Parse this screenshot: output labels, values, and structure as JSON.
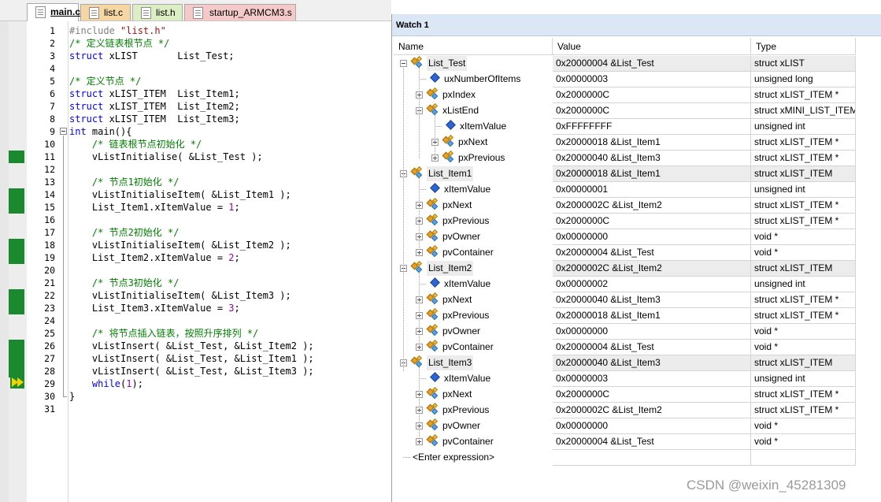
{
  "tabs": [
    {
      "label": "main.c",
      "active": true
    },
    {
      "label": "list.c",
      "active": false
    },
    {
      "label": "list.h",
      "active": false
    },
    {
      "label": "startup_ARMCM3.s",
      "active": false
    }
  ],
  "code_lines": [
    {
      "n": "1",
      "t": "#include \"list.h\""
    },
    {
      "n": "2",
      "t": "/* 定义链表根节点 */"
    },
    {
      "n": "3",
      "t": "struct xLIST       List_Test;"
    },
    {
      "n": "4",
      "t": ""
    },
    {
      "n": "5",
      "t": "/* 定义节点 */"
    },
    {
      "n": "6",
      "t": "struct xLIST_ITEM  List_Item1;"
    },
    {
      "n": "7",
      "t": "struct xLIST_ITEM  List_Item2;"
    },
    {
      "n": "8",
      "t": "struct xLIST_ITEM  List_Item3;"
    },
    {
      "n": "9",
      "t": "int main(){"
    },
    {
      "n": "10",
      "t": "    /* 链表根节点初始化 */"
    },
    {
      "n": "11",
      "t": "    vListInitialise( &List_Test );"
    },
    {
      "n": "12",
      "t": ""
    },
    {
      "n": "13",
      "t": "    /* 节点1初始化 */"
    },
    {
      "n": "14",
      "t": "    vListInitialiseItem( &List_Item1 );"
    },
    {
      "n": "15",
      "t": "    List_Item1.xItemValue = 1;"
    },
    {
      "n": "16",
      "t": ""
    },
    {
      "n": "17",
      "t": "    /* 节点2初始化 */"
    },
    {
      "n": "18",
      "t": "    vListInitialiseItem( &List_Item2 );"
    },
    {
      "n": "19",
      "t": "    List_Item2.xItemValue = 2;"
    },
    {
      "n": "20",
      "t": ""
    },
    {
      "n": "21",
      "t": "    /* 节点3初始化 */"
    },
    {
      "n": "22",
      "t": "    vListInitialiseItem( &List_Item3 );"
    },
    {
      "n": "23",
      "t": "    List_Item3.xItemValue = 3;"
    },
    {
      "n": "24",
      "t": ""
    },
    {
      "n": "25",
      "t": "    /* 将节点插入链表，按照升序排列 */"
    },
    {
      "n": "26",
      "t": "    vListInsert( &List_Test, &List_Item2 );"
    },
    {
      "n": "27",
      "t": "    vListInsert( &List_Test, &List_Item1 );"
    },
    {
      "n": "28",
      "t": "    vListInsert( &List_Test, &List_Item3 );"
    },
    {
      "n": "29",
      "t": "    while(1);"
    },
    {
      "n": "30",
      "t": "}"
    },
    {
      "n": "31",
      "t": ""
    }
  ],
  "watch": {
    "title": "Watch 1",
    "headers": {
      "name": "Name",
      "value": "Value",
      "type": "Type"
    },
    "rows": [
      {
        "name": "List_Test",
        "value": "0x20000004 &List_Test",
        "type": "struct xLIST",
        "root": true
      },
      {
        "name": "uxNumberOfItems",
        "value": "0x00000003",
        "type": "unsigned long"
      },
      {
        "name": "pxIndex",
        "value": "0x2000000C",
        "type": "struct xLIST_ITEM *"
      },
      {
        "name": "xListEnd",
        "value": "0x2000000C",
        "type": "struct xMINI_LIST_ITEM"
      },
      {
        "name": "xItemValue",
        "value": "0xFFFFFFFF",
        "type": "unsigned int"
      },
      {
        "name": "pxNext",
        "value": "0x20000018 &List_Item1",
        "type": "struct xLIST_ITEM *"
      },
      {
        "name": "pxPrevious",
        "value": "0x20000040 &List_Item3",
        "type": "struct xLIST_ITEM *"
      },
      {
        "name": "List_Item1",
        "value": "0x20000018 &List_Item1",
        "type": "struct xLIST_ITEM",
        "root": true
      },
      {
        "name": "xItemValue",
        "value": "0x00000001",
        "type": "unsigned int"
      },
      {
        "name": "pxNext",
        "value": "0x2000002C &List_Item2",
        "type": "struct xLIST_ITEM *"
      },
      {
        "name": "pxPrevious",
        "value": "0x2000000C",
        "type": "struct xLIST_ITEM *"
      },
      {
        "name": "pvOwner",
        "value": "0x00000000",
        "type": "void *"
      },
      {
        "name": "pvContainer",
        "value": "0x20000004 &List_Test",
        "type": "void *"
      },
      {
        "name": "List_Item2",
        "value": "0x2000002C &List_Item2",
        "type": "struct xLIST_ITEM",
        "root": true
      },
      {
        "name": "xItemValue",
        "value": "0x00000002",
        "type": "unsigned int"
      },
      {
        "name": "pxNext",
        "value": "0x20000040 &List_Item3",
        "type": "struct xLIST_ITEM *"
      },
      {
        "name": "pxPrevious",
        "value": "0x20000018 &List_Item1",
        "type": "struct xLIST_ITEM *"
      },
      {
        "name": "pvOwner",
        "value": "0x00000000",
        "type": "void *"
      },
      {
        "name": "pvContainer",
        "value": "0x20000004 &List_Test",
        "type": "void *"
      },
      {
        "name": "List_Item3",
        "value": "0x20000040 &List_Item3",
        "type": "struct xLIST_ITEM",
        "root": true
      },
      {
        "name": "xItemValue",
        "value": "0x00000003",
        "type": "unsigned int"
      },
      {
        "name": "pxNext",
        "value": "0x2000000C",
        "type": "struct xLIST_ITEM *"
      },
      {
        "name": "pxPrevious",
        "value": "0x2000002C &List_Item2",
        "type": "struct xLIST_ITEM *"
      },
      {
        "name": "pvOwner",
        "value": "0x00000000",
        "type": "void *"
      },
      {
        "name": "pvContainer",
        "value": "0x20000004 &List_Test",
        "type": "void *"
      }
    ],
    "enter_expression": "<Enter expression>"
  },
  "watermark": "CSDN @weixin_45281309",
  "colors": {
    "keyword": "#0000ff",
    "comment": "#008000",
    "number": "#a000a0",
    "preprocessor": "#808080",
    "string": "#a31515",
    "exec_marker": "#1b8a2e",
    "watch_title_bg": "#dbe7f5"
  }
}
